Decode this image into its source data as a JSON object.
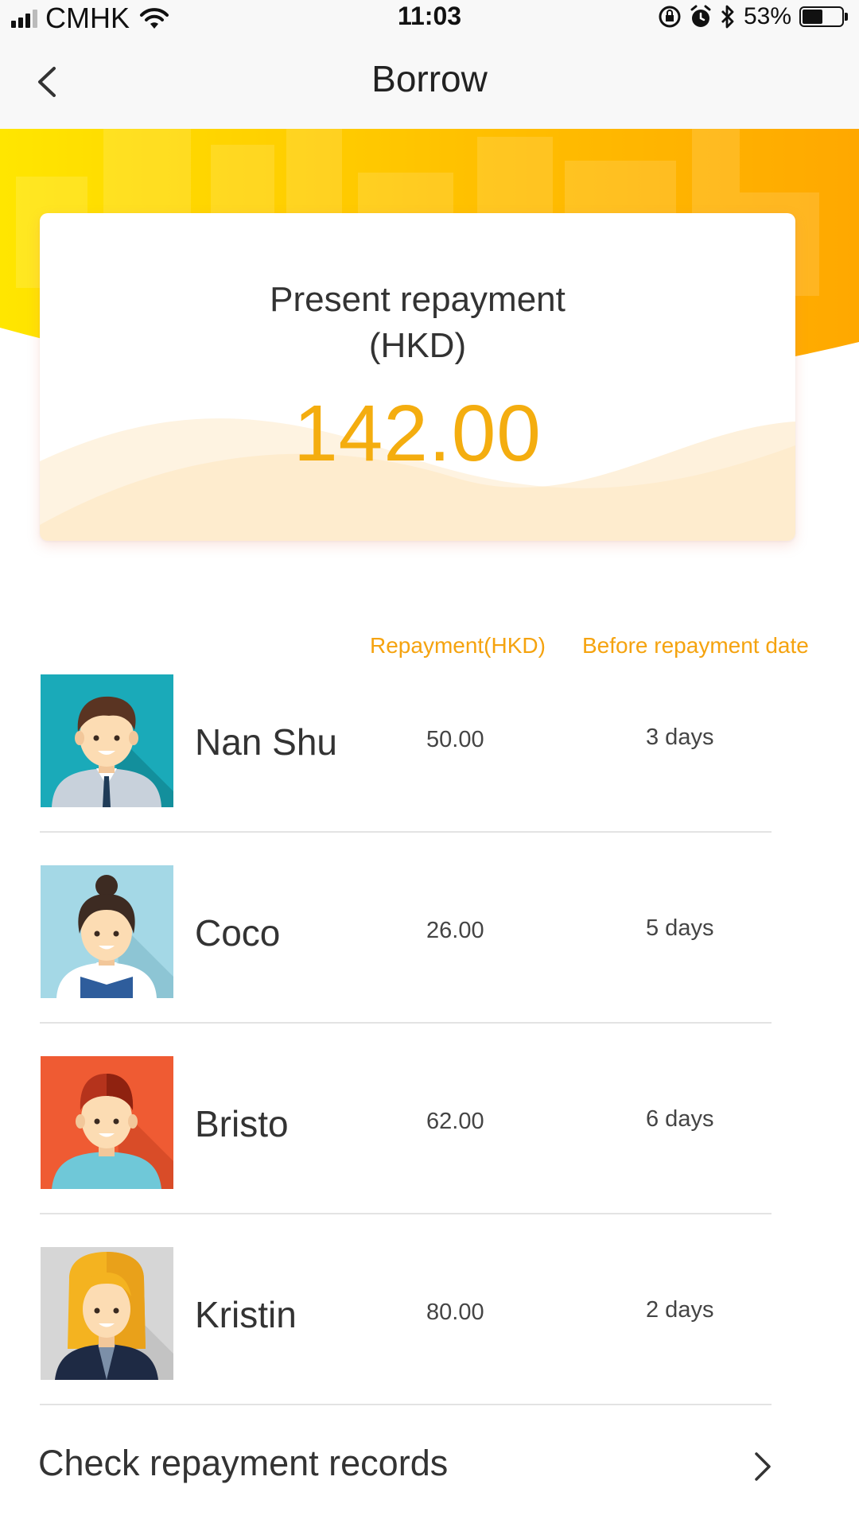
{
  "status_bar": {
    "carrier": "CMHK",
    "time": "11:03",
    "battery_percent": "53%",
    "battery_level": 0.53
  },
  "nav": {
    "title": "Borrow"
  },
  "summary": {
    "title_line1": "Present repayment",
    "title_line2": "(HKD)",
    "amount": "142.00"
  },
  "columns": {
    "repayment": "Repayment(HKD)",
    "before_date": "Before repayment date"
  },
  "borrowers": [
    {
      "name": "Nan Shu",
      "repayment": "50.00",
      "days": "3 days",
      "avatar": "man-avatar-icon",
      "bg": "#1aaab9"
    },
    {
      "name": "Coco",
      "repayment": "26.00",
      "days": "5 days",
      "avatar": "woman-bun-avatar-icon",
      "bg": "#a4d8e6"
    },
    {
      "name": "Bristo",
      "repayment": "62.00",
      "days": "6 days",
      "avatar": "man-redhair-avatar-icon",
      "bg": "#ef5b33"
    },
    {
      "name": "Kristin",
      "repayment": "80.00",
      "days": "2 days",
      "avatar": "woman-blonde-avatar-icon",
      "bg": "#d6d6d6"
    }
  ],
  "footer": {
    "records_label": "Check repayment records"
  },
  "colors": {
    "accent": "#f4ad0f",
    "banner_start": "#ffe000",
    "banner_end": "#ffaa00"
  }
}
